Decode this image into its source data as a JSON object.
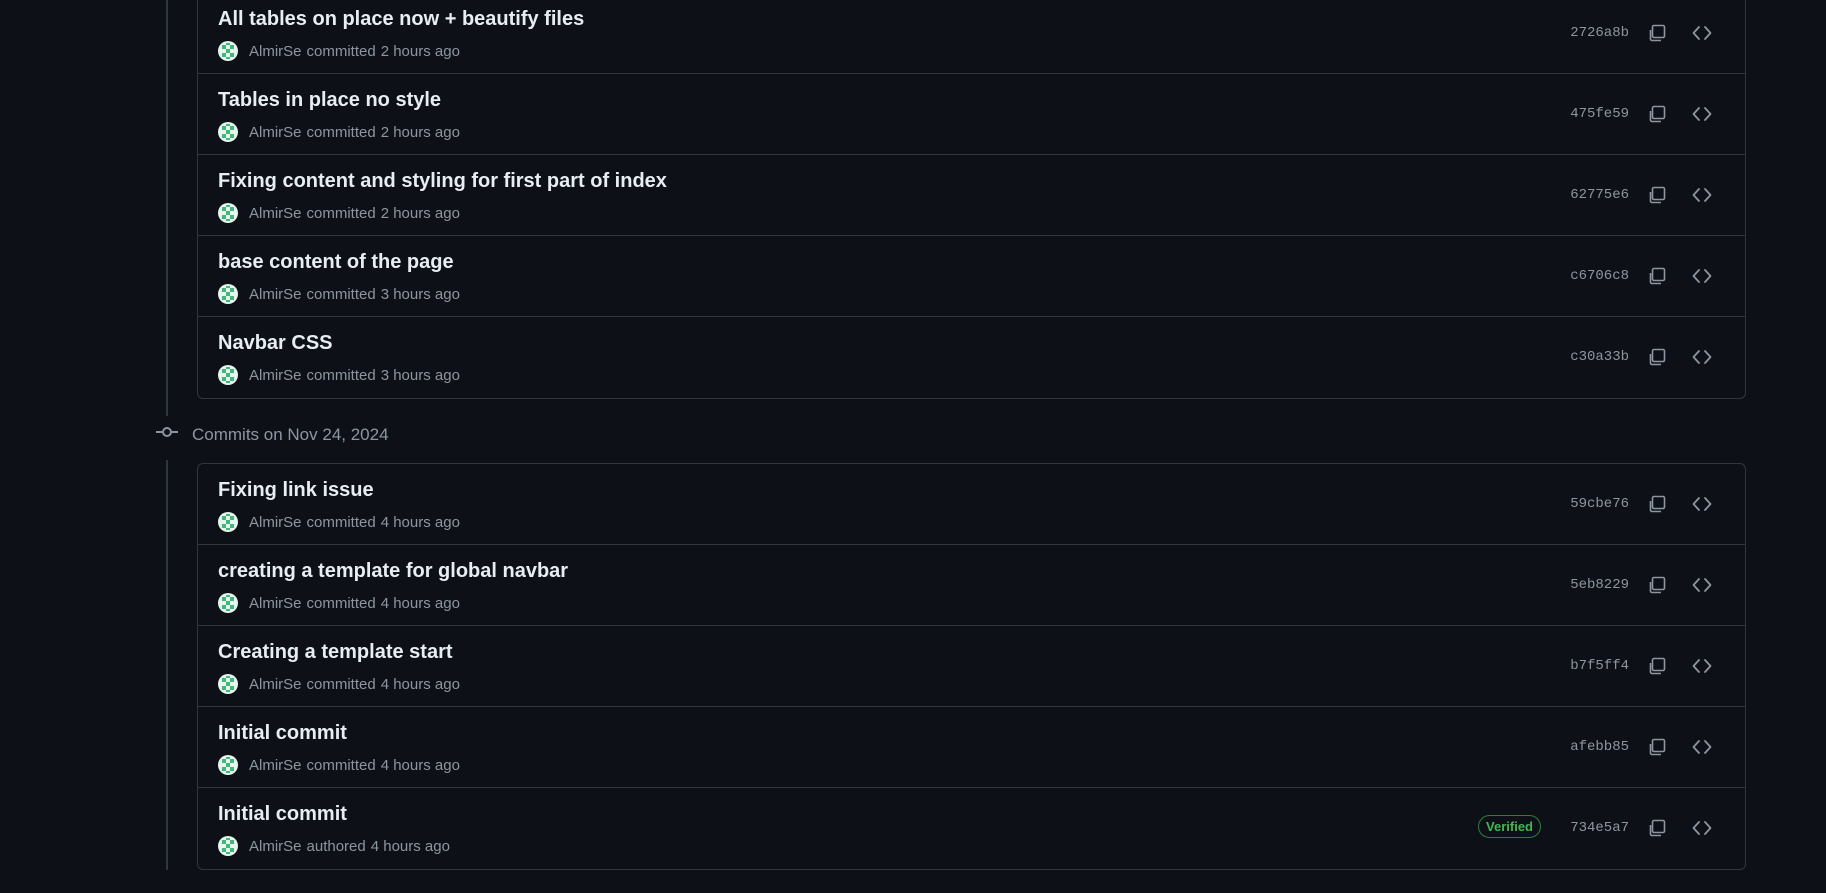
{
  "colors": {
    "background": "#0d1117",
    "border": "#30363d",
    "text_primary": "#e6edf3",
    "text_muted": "#8d96a0",
    "verified_green": "#3fb950"
  },
  "icons": {
    "copy": "copy-icon",
    "browse": "code-icon",
    "group": "git-commit-icon",
    "avatar": "identicon-avatar"
  },
  "groups": [
    {
      "date_label": "",
      "commits": [
        {
          "title": "All tables on place now + beautify files",
          "author": "AlmirSe",
          "action": "committed",
          "time": "2 hours ago",
          "sha": "2726a8b",
          "verified": ""
        },
        {
          "title": "Tables in place no style",
          "author": "AlmirSe",
          "action": "committed",
          "time": "2 hours ago",
          "sha": "475fe59",
          "verified": ""
        },
        {
          "title": "Fixing content and styling for first part of index",
          "author": "AlmirSe",
          "action": "committed",
          "time": "2 hours ago",
          "sha": "62775e6",
          "verified": ""
        },
        {
          "title": "base content of the page",
          "author": "AlmirSe",
          "action": "committed",
          "time": "3 hours ago",
          "sha": "c6706c8",
          "verified": ""
        },
        {
          "title": "Navbar CSS",
          "author": "AlmirSe",
          "action": "committed",
          "time": "3 hours ago",
          "sha": "c30a33b",
          "verified": ""
        }
      ]
    },
    {
      "date_label": "Commits on Nov 24, 2024",
      "commits": [
        {
          "title": "Fixing link issue",
          "author": "AlmirSe",
          "action": "committed",
          "time": "4 hours ago",
          "sha": "59cbe76",
          "verified": ""
        },
        {
          "title": "creating a template for global navbar",
          "author": "AlmirSe",
          "action": "committed",
          "time": "4 hours ago",
          "sha": "5eb8229",
          "verified": ""
        },
        {
          "title": "Creating a template start",
          "author": "AlmirSe",
          "action": "committed",
          "time": "4 hours ago",
          "sha": "b7f5ff4",
          "verified": ""
        },
        {
          "title": "Initial commit",
          "author": "AlmirSe",
          "action": "committed",
          "time": "4 hours ago",
          "sha": "afebb85",
          "verified": ""
        },
        {
          "title": "Initial commit",
          "author": "AlmirSe",
          "action": "authored",
          "time": "4 hours ago",
          "sha": "734e5a7",
          "verified": "Verified"
        }
      ]
    }
  ]
}
